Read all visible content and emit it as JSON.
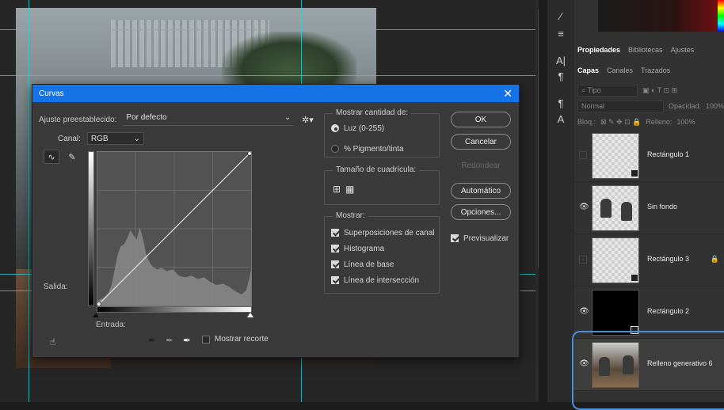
{
  "dialog": {
    "title": "Curvas",
    "preset_label": "Ajuste preestablecido:",
    "preset_value": "Por defecto",
    "channel_label": "Canal:",
    "channel_value": "RGB",
    "output_label": "Salida:",
    "input_label": "Entrada:",
    "show_clipping": "Mostrar recorte",
    "show_amount": {
      "title": "Mostrar cantidad de:",
      "light": "Luz (0-255)",
      "pigment": "% Pigmento/tinta"
    },
    "grid_size": {
      "title": "Tamaño de cuadrícula:"
    },
    "show": {
      "title": "Mostrar:",
      "channel_overlays": "Superposiciones de canal",
      "histogram": "Histograma",
      "baseline": "Línea de base",
      "intersection": "Línea de intersección"
    },
    "buttons": {
      "ok": "OK",
      "cancel": "Cancelar",
      "smooth": "Redondear",
      "auto": "Automático",
      "options": "Opciones..."
    },
    "preview": "Previsualizar"
  },
  "panel": {
    "top_tabs": [
      "Propiedades",
      "Bibliotecas",
      "Ajustes"
    ],
    "layer_tabs": [
      "Capas",
      "Canales",
      "Trazados"
    ],
    "filter_placeholder": "Tipo",
    "blend_mode": "Normal",
    "opacity_label": "Opacidad:",
    "opacity_value": "100%",
    "lock_label": "Bloq.:",
    "fill_label": "Relleno:",
    "fill_value": "100%",
    "layers": [
      {
        "name": "Rectángulo 1",
        "visible": false,
        "thumb": "checker"
      },
      {
        "name": "Sin fondo",
        "visible": true,
        "thumb": "people"
      },
      {
        "name": "Rectángulo 3",
        "visible": false,
        "thumb": "checker",
        "locked": true
      },
      {
        "name": "Rectángulo 2",
        "visible": true,
        "thumb": "black"
      },
      {
        "name": "Relleno generativo 6",
        "visible": true,
        "thumb": "photo",
        "selected": true
      }
    ]
  },
  "colors": {
    "accent": "#1473e6",
    "guide": "#2fd0d8",
    "selection": "#4a90d9"
  }
}
